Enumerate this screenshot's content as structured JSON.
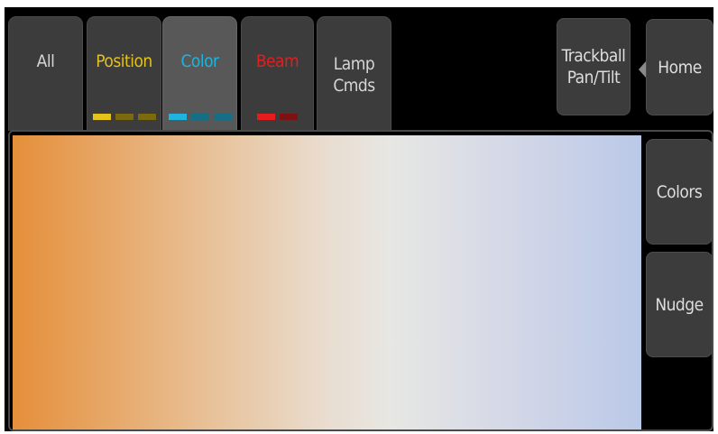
{
  "tabs": [
    {
      "id": "all",
      "label": "All",
      "color": "#d6d6d6",
      "active": false,
      "indicators": []
    },
    {
      "id": "position",
      "label": "Position",
      "color": "#e4c21a",
      "active": false,
      "indicators": [
        "#e4c21a",
        "#7d6a0e",
        "#7d6a0e"
      ]
    },
    {
      "id": "color",
      "label": "Color",
      "color": "#1fb4de",
      "active": true,
      "indicators": [
        "#1fb4de",
        "#146e86",
        "#146e86"
      ]
    },
    {
      "id": "beam",
      "label": "Beam",
      "color": "#e51d1d",
      "active": false,
      "indicators": [
        "#e51d1d",
        "#7e1111"
      ]
    },
    {
      "id": "lamp",
      "label_line1": "Lamp",
      "label_line2": "Cmds",
      "color": "#d6d6d6",
      "active": false,
      "indicators": []
    }
  ],
  "header": {
    "trackball_line1": "Trackball",
    "trackball_line2": "Pan/Tilt",
    "home_label": "Home"
  },
  "side": {
    "colors_label": "Colors",
    "nudge_label": "Nudge"
  },
  "picker": {
    "start_color": "#e58f3a",
    "mid_color": "#e7e7e3",
    "end_color": "#bac9e8"
  }
}
